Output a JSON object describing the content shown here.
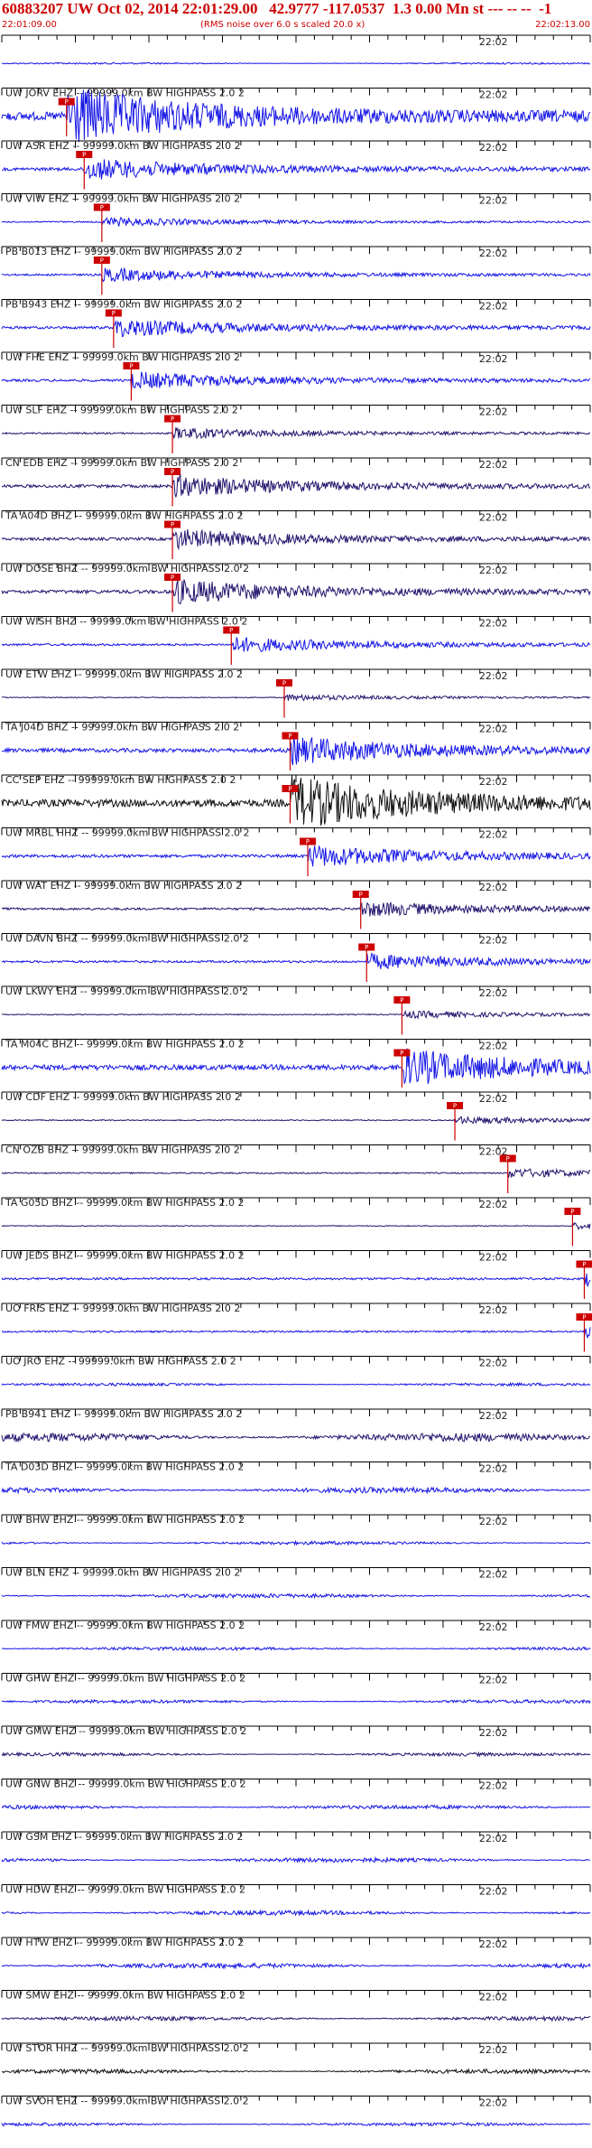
{
  "header": {
    "title": "60883207 UW Oct 02, 2014 22:01:29.00   42.9777 -117.0537  1.3 0.00 Mn st --- -- --  -1",
    "start_time": "22:01:09.00",
    "subtitle": "(RMS noise over 6.0 s scaled 20.0 x)",
    "end_time": "22:02:13.00"
  },
  "chart_data": {
    "type": "line",
    "title": "60883207 UW Oct 02, 2014 22:01:29.00   42.9777 -117.0537  1.3 0.00 Mn st --- -- --  -1",
    "xlabel": "",
    "ylabel": "",
    "x_range": [
      "22:01:09.00",
      "22:02:13.00"
    ],
    "time_marker": "22:02",
    "colors": {
      "blue": "#1515e6",
      "navy": "#23146e",
      "black": "#111111",
      "pick": "#cc0000"
    },
    "pick_label": "P",
    "traces": [
      {
        "label": "",
        "color": "blue",
        "amplitude": 0.06,
        "pick_fraction": null
      },
      {
        "label": "UW JORV EHZ -- 99999.0km BW  HIGHPASS  2.0  2",
        "color": "blue",
        "amplitude": 0.95,
        "pick_fraction": 0.11
      },
      {
        "label": "UW ASR EHZ -- 99999.0km BW  HIGHPASS  2.0  2",
        "color": "blue",
        "amplitude": 0.35,
        "pick_fraction": 0.14
      },
      {
        "label": "UW VIW EHZ -- 99999.0km BW  HIGHPASS  2.0  2",
        "color": "blue",
        "amplitude": 0.15,
        "pick_fraction": 0.17
      },
      {
        "label": "PB B013 EHZ -- 99999.0km BW  HIGHPASS  2.0  2",
        "color": "blue",
        "amplitude": 0.22,
        "pick_fraction": 0.17
      },
      {
        "label": "PB B943 EHZ -- 99999.0km BW  HIGHPASS  2.0  2",
        "color": "blue",
        "amplitude": 0.3,
        "pick_fraction": 0.19
      },
      {
        "label": "UW FHE EHZ -- 99999.0km BW  HIGHPASS  2.0  2",
        "color": "blue",
        "amplitude": 0.28,
        "pick_fraction": 0.22
      },
      {
        "label": "UW SLF EHZ -- 99999.0km BW  HIGHPASS  2.0  2",
        "color": "navy",
        "amplitude": 0.18,
        "pick_fraction": 0.29
      },
      {
        "label": "CN EDB EHZ -- 99999.0km BW  HIGHPASS  2.0  2",
        "color": "navy",
        "amplitude": 0.35,
        "pick_fraction": 0.29
      },
      {
        "label": "TA A04D BHZ -- 99999.0km BW  HIGHPASS  2.0  2",
        "color": "navy",
        "amplitude": 0.32,
        "pick_fraction": 0.29
      },
      {
        "label": "UW DOSE BHZ -- 99999.0km BW  HIGHPASS  2.0  2",
        "color": "navy",
        "amplitude": 0.4,
        "pick_fraction": 0.29
      },
      {
        "label": "UW WISH BHZ -- 99999.0km BW  HIGHPASS  2.0  2",
        "color": "blue",
        "amplitude": 0.25,
        "pick_fraction": 0.39
      },
      {
        "label": "UW ETW EHZ -- 99999.0km BW  HIGHPASS  2.0  2",
        "color": "navy",
        "amplitude": 0.1,
        "pick_fraction": 0.48
      },
      {
        "label": "TA J04D BHZ -- 99999.0km BW  HIGHPASS  2.0  2",
        "color": "blue",
        "amplitude": 0.45,
        "pick_fraction": 0.49
      },
      {
        "label": "CC SEP EHZ -- 99999.0km BW  HIGHPASS  2.0  2",
        "color": "black",
        "amplitude": 0.85,
        "pick_fraction": 0.49
      },
      {
        "label": "UW MRBL HHZ -- 99999.0km BW  HIGHPASS  2.0  2",
        "color": "blue",
        "amplitude": 0.35,
        "pick_fraction": 0.52
      },
      {
        "label": "UW WAT EHZ -- 99999.0km BW  HIGHPASS  2.0  2",
        "color": "navy",
        "amplitude": 0.25,
        "pick_fraction": 0.61
      },
      {
        "label": "UW DAVN BHZ -- 99999.0km BW  HIGHPASS  2.0  2",
        "color": "blue",
        "amplitude": 0.25,
        "pick_fraction": 0.62
      },
      {
        "label": "UW LKWY EHZ -- 99999.0km BW  HIGHPASS  2.0  2",
        "color": "navy",
        "amplitude": 0.12,
        "pick_fraction": 0.68
      },
      {
        "label": "TA M04C BHZ -- 99999.0km BW  HIGHPASS  2.0  2",
        "color": "blue",
        "amplitude": 0.6,
        "pick_fraction": 0.68
      },
      {
        "label": "UW CDF EHZ -- 99999.0km BW  HIGHPASS  2.0  2",
        "color": "navy",
        "amplitude": 0.12,
        "pick_fraction": 0.77
      },
      {
        "label": "CN OZB BHZ -- 99999.0km BW  HIGHPASS  2.0  2",
        "color": "navy",
        "amplitude": 0.15,
        "pick_fraction": 0.86
      },
      {
        "label": "TA G05D BHZ -- 99999.0km BW  HIGHPASS  2.0  2",
        "color": "navy",
        "amplitude": 0.1,
        "pick_fraction": 0.97
      },
      {
        "label": "UW JEDS BHZ -- 99999.0km BW  HIGHPASS  2.0  2",
        "color": "blue",
        "amplitude": 0.25,
        "pick_fraction": 0.99
      },
      {
        "label": "UO FRIS EHZ -- 99999.0km BW  HIGHPASS  2.0  2",
        "color": "blue",
        "amplitude": 0.2,
        "pick_fraction": 0.99
      },
      {
        "label": "UO JRO EHZ -- 99999.0km BW  HIGHPASS  2.0  2",
        "color": "blue",
        "amplitude": 0.1,
        "pick_fraction": null
      },
      {
        "label": "PB B941 EHZ -- 99999.0km BW  HIGHPASS  2.0  2",
        "color": "navy",
        "amplitude": 0.3,
        "pick_fraction": null
      },
      {
        "label": "TA D03D BHZ -- 99999.0km BW  HIGHPASS  2.0  2",
        "color": "blue",
        "amplitude": 0.2,
        "pick_fraction": null
      },
      {
        "label": "UW BHW EHZ -- 99999.0km BW  HIGHPASS  2.0  2",
        "color": "blue",
        "amplitude": 0.12,
        "pick_fraction": null
      },
      {
        "label": "UW BLN EHZ -- 99999.0km BW  HIGHPASS  2.0  2",
        "color": "blue",
        "amplitude": 0.15,
        "pick_fraction": null
      },
      {
        "label": "UW FMW EHZ -- 99999.0km BW  HIGHPASS  2.0  2",
        "color": "blue",
        "amplitude": 0.12,
        "pick_fraction": null
      },
      {
        "label": "UW GHW EHZ -- 99999.0km BW  HIGHPASS  2.0  2",
        "color": "blue",
        "amplitude": 0.12,
        "pick_fraction": null
      },
      {
        "label": "UW GMW EHZ -- 99999.0km BW  HIGHPASS  2.0  2",
        "color": "navy",
        "amplitude": 0.12,
        "pick_fraction": null
      },
      {
        "label": "UW GNW BHZ -- 99999.0km BW  HIGHPASS  2.0  2",
        "color": "blue",
        "amplitude": 0.14,
        "pick_fraction": null
      },
      {
        "label": "UW GSM EHZ -- 99999.0km BW  HIGHPASS  2.0  2",
        "color": "blue",
        "amplitude": 0.16,
        "pick_fraction": null
      },
      {
        "label": "UW HDW EHZ -- 99999.0km BW  HIGHPASS  2.0  2",
        "color": "blue",
        "amplitude": 0.16,
        "pick_fraction": null
      },
      {
        "label": "UW HTW EHZ -- 99999.0km BW  HIGHPASS  2.0  2",
        "color": "blue",
        "amplitude": 0.18,
        "pick_fraction": null
      },
      {
        "label": "UW SMW EHZ -- 99999.0km BW  HIGHPASS  2.0  2",
        "color": "navy",
        "amplitude": 0.15,
        "pick_fraction": null
      },
      {
        "label": "UW STOR HHZ -- 99999.0km BW  HIGHPASS  2.0  2",
        "color": "black",
        "amplitude": 0.15,
        "pick_fraction": null
      },
      {
        "label": "UW SVOH EHZ -- 99999.0km BW  HIGHPASS  2.0  2",
        "color": "blue",
        "amplitude": 0.12,
        "pick_fraction": null
      }
    ]
  }
}
